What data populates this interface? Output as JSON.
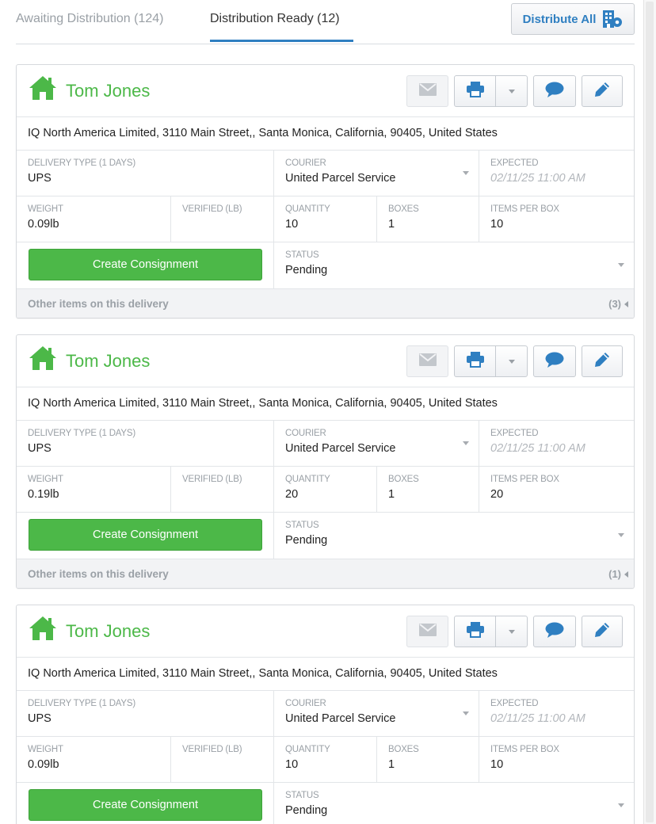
{
  "tabs": [
    {
      "label": "Awaiting Distribution (124)"
    },
    {
      "label": "Distribution Ready (12)"
    }
  ],
  "distribute_all": {
    "label": "Distribute All",
    "icon": "building-icon"
  },
  "labels": {
    "delivery_type": "DELIVERY TYPE (1 DAYS)",
    "courier": "COURIER",
    "expected": "EXPECTED",
    "weight": "WEIGHT",
    "verified": "VERIFIED (LB)",
    "quantity": "QUANTITY",
    "boxes": "BOXES",
    "items_per_box": "ITEMS PER BOX",
    "status": "STATUS",
    "create_consignment": "Create Consignment",
    "other_items": "Other items on this delivery"
  },
  "colors": {
    "accent_blue": "#2f7fc1",
    "accent_green": "#4cb848"
  },
  "cards": [
    {
      "name": "Tom Jones",
      "address": "IQ North America Limited, 3110 Main Street,, Santa Monica, California, 90405, United States",
      "delivery_type": "UPS",
      "courier": "United Parcel Service",
      "expected": "02/11/25 11:00 AM",
      "weight": "0.09lb",
      "verified": "",
      "quantity": "10",
      "boxes": "1",
      "items_per_box": "10",
      "status": "Pending",
      "other_count": "(3)"
    },
    {
      "name": "Tom Jones",
      "address": "IQ North America Limited, 3110 Main Street,, Santa Monica, California, 90405, United States",
      "delivery_type": "UPS",
      "courier": "United Parcel Service",
      "expected": "02/11/25 11:00 AM",
      "weight": "0.19lb",
      "verified": "",
      "quantity": "20",
      "boxes": "1",
      "items_per_box": "20",
      "status": "Pending",
      "other_count": "(1)"
    },
    {
      "name": "Tom Jones",
      "address": "IQ North America Limited, 3110 Main Street,, Santa Monica, California, 90405, United States",
      "delivery_type": "UPS",
      "courier": "United Parcel Service",
      "expected": "02/11/25 11:00 AM",
      "weight": "0.09lb",
      "verified": "",
      "quantity": "10",
      "boxes": "1",
      "items_per_box": "10",
      "status": "Pending",
      "other_count": ""
    }
  ]
}
